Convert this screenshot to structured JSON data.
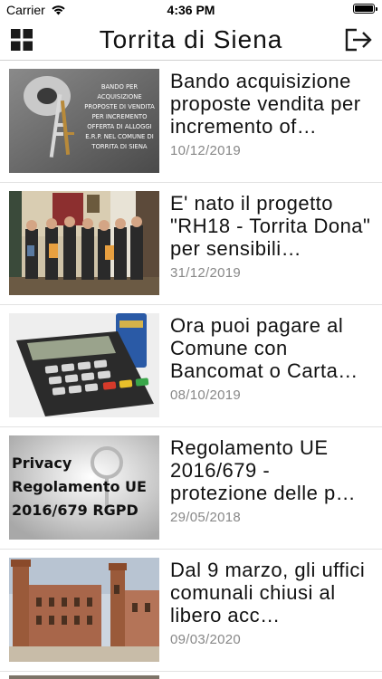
{
  "status": {
    "carrier": "Carrier",
    "time": "4:36 PM"
  },
  "nav": {
    "title": "Torrita di Siena"
  },
  "news": [
    {
      "title": "Bando acquisizione proposte vendita per incremento of…",
      "date": "10/12/2019",
      "thumb_text": [
        "BANDO PER",
        "ACQUISIZIONE",
        "PROPOSTE DI VENDITA",
        "PER INCREMENTO",
        "OFFERTA DI ALLOGGI",
        "E.R.P. NEL COMUNE DI",
        "TORRITA DI SIENA"
      ]
    },
    {
      "title": "E' nato il progetto \"RH18 - Torrita Dona\" per sensibili…",
      "date": "31/12/2019"
    },
    {
      "title": "Ora puoi pagare al Comune con Bancomat o Carta…",
      "date": "08/10/2019"
    },
    {
      "title": "Regolamento UE 2016/679 - protezione delle p…",
      "date": "29/05/2018",
      "thumb_text": [
        "Privacy",
        "Regolamento UE",
        "2016/679 RGPD"
      ]
    },
    {
      "title": "Dal 9 marzo, gli uffici comunali chiusi al libero acc…",
      "date": "09/03/2020"
    }
  ]
}
